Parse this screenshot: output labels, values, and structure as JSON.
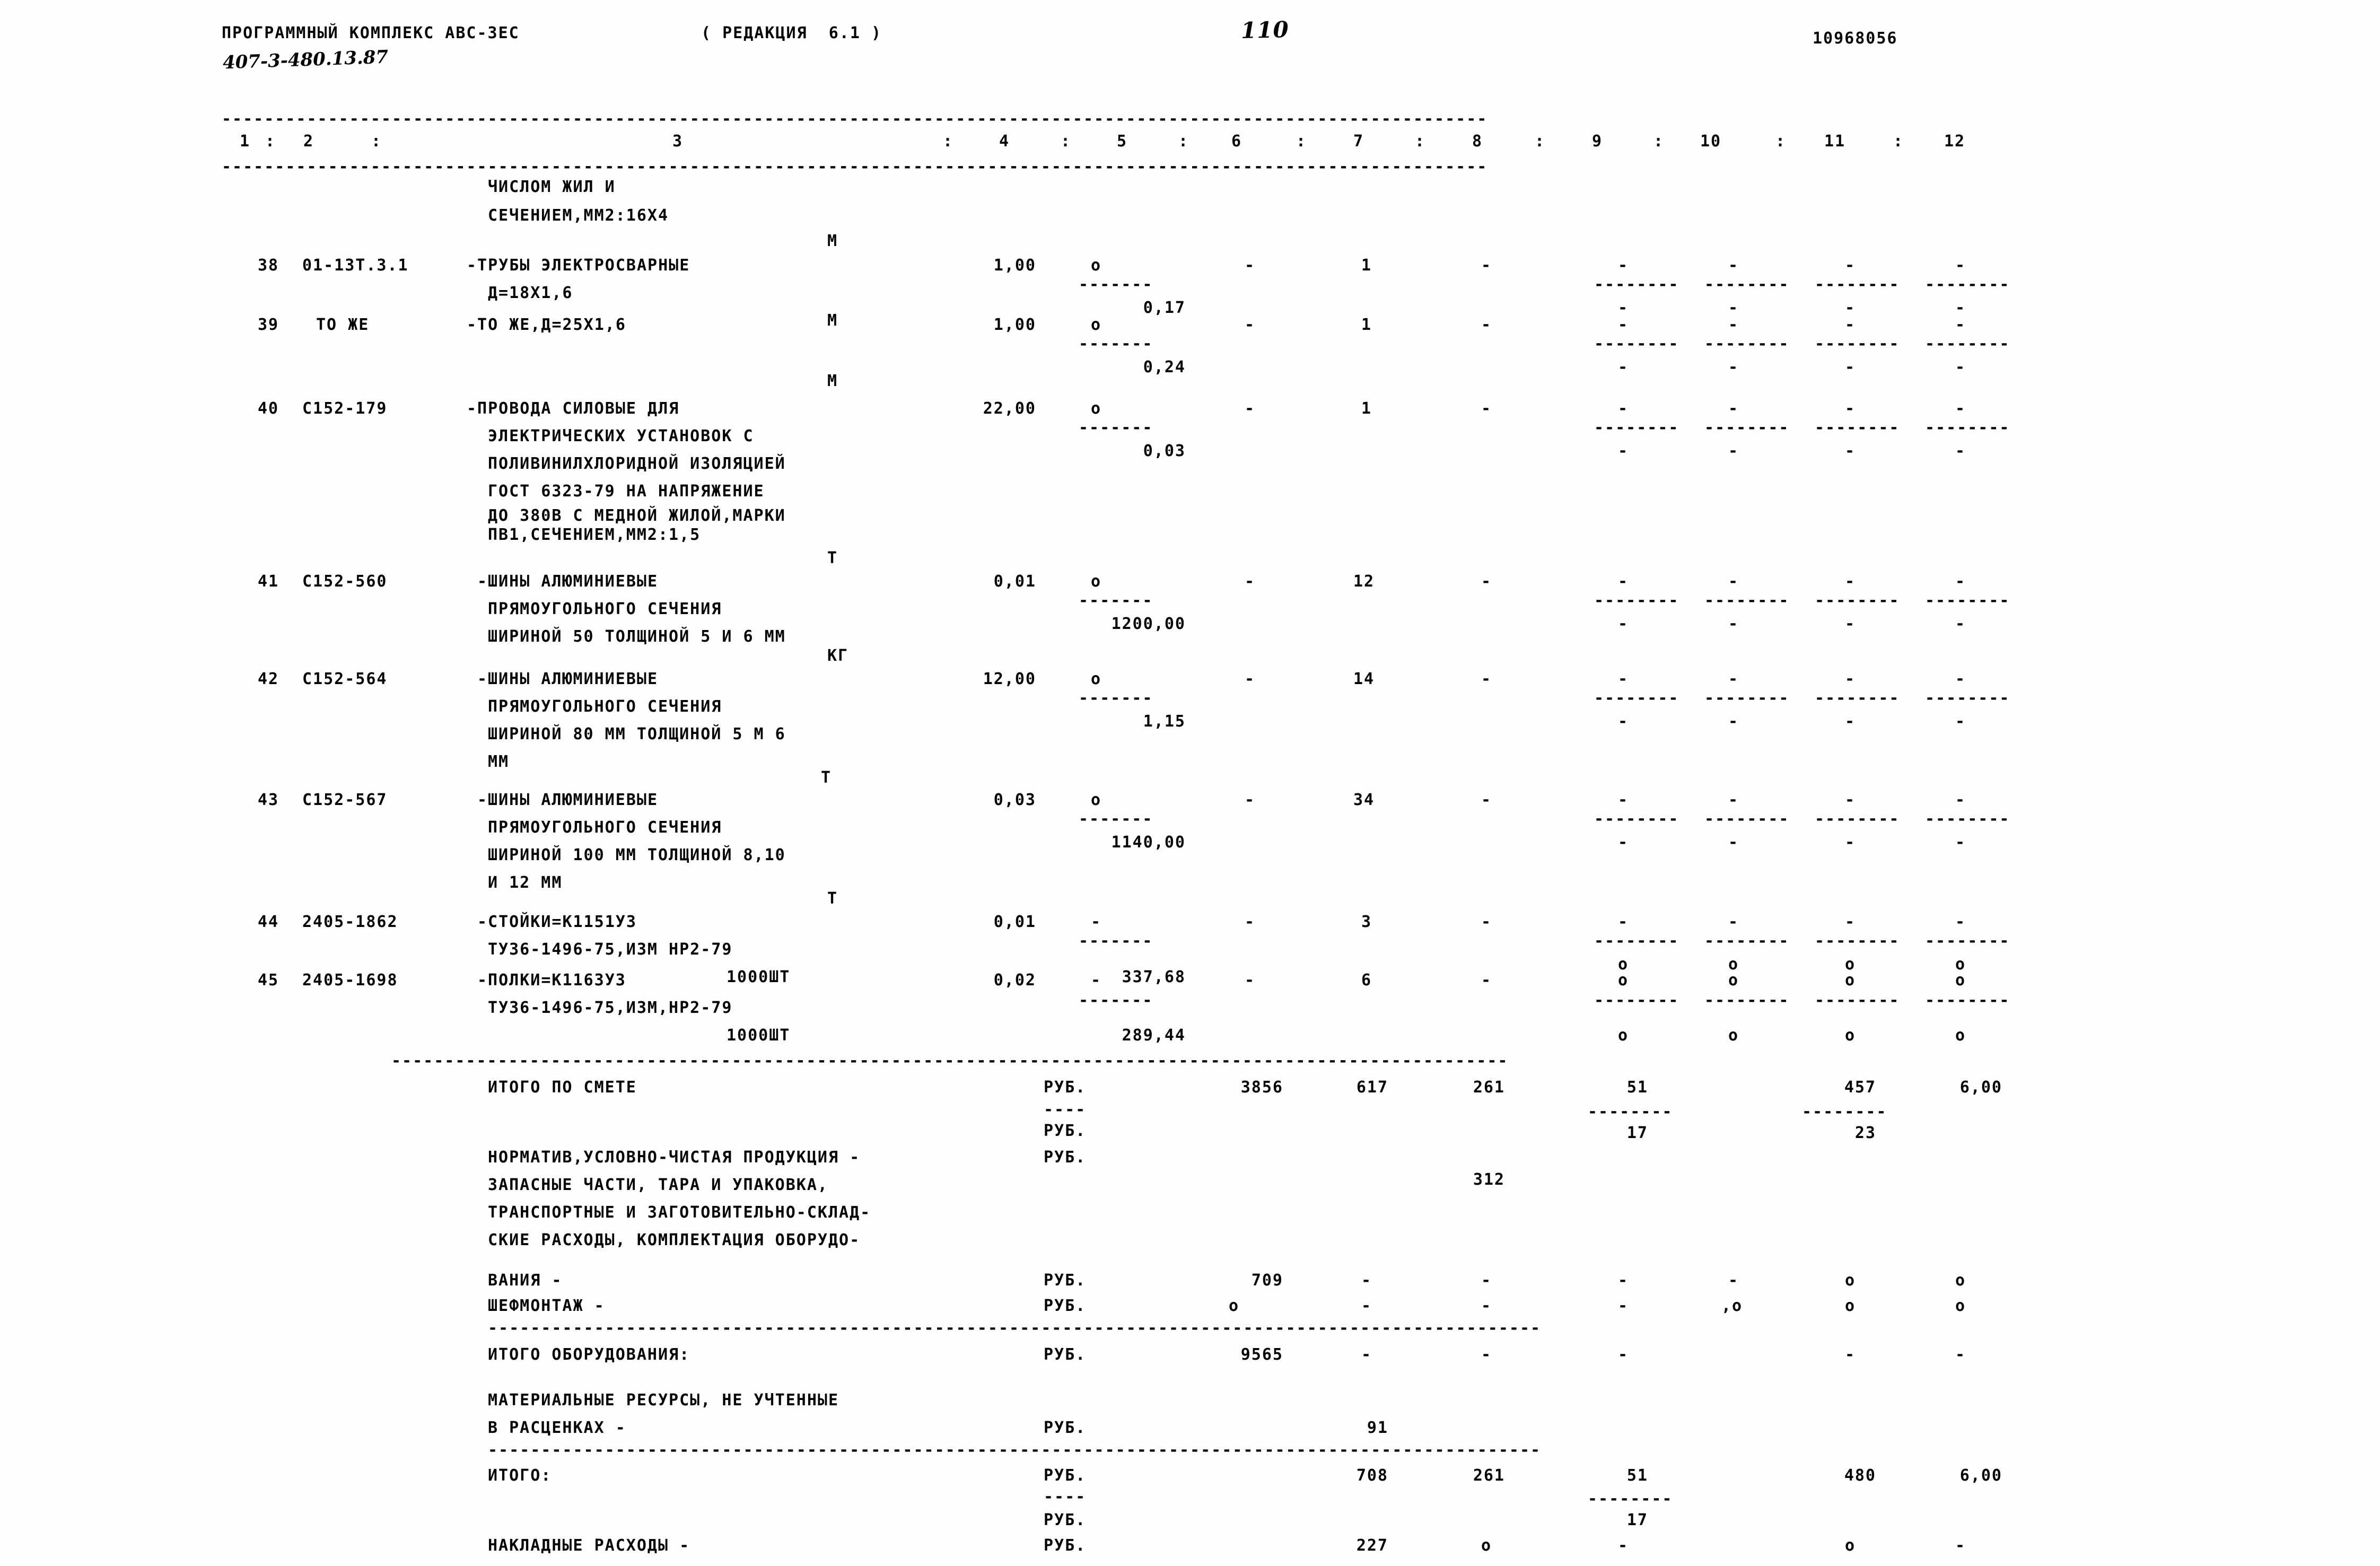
{
  "header": {
    "program_title": "ПРОГРАММНЫЙ КОМПЛЕКС АВС-3ЕС",
    "revision": "( РЕДАКЦИЯ  6.1 )",
    "doc_code": "407-3-480.13.87",
    "page_number": "110",
    "doc_id": "10968056"
  },
  "columns": {
    "separator": ":",
    "labels": [
      "1",
      "2",
      "3",
      "4",
      "5",
      "6",
      "7",
      "8",
      "9",
      "10",
      "11",
      "12"
    ]
  },
  "continued_row": {
    "desc_line1": "ЧИСЛОМ ЖИЛ И",
    "desc_line2": "СЕЧЕНИЕМ,ММ2:16Х4"
  },
  "rows": [
    {
      "num": "38",
      "code": "01-13Т.3.1",
      "desc": [
        "-ТРУБЫ ЭЛЕКТРОСВАРНЫЕ",
        "Д=18Х1,6"
      ],
      "unit": "М",
      "qty": "1,00",
      "price_dot": "o",
      "price": "0,17",
      "c6": "-",
      "c7": "1",
      "c8": "-",
      "c9": "-",
      "c10": "-",
      "c11": "-",
      "c12": "-"
    },
    {
      "num": "39",
      "code": "ТО ЖЕ",
      "desc": [
        "-ТО ЖЕ,Д=25Х1,6"
      ],
      "unit": "М",
      "qty": "1,00",
      "price_dot": "o",
      "price": "0,24",
      "c6": "-",
      "c7": "1",
      "c8": "-",
      "c9": "-",
      "c10": "-",
      "c11": "-",
      "c12": "-"
    },
    {
      "num": "40",
      "code": "С152-179",
      "desc": [
        "-ПРОВОДА СИЛОВЫЕ ДЛЯ",
        "ЭЛЕКТРИЧЕСКИХ УСТАНОВОК С",
        "ПОЛИВИНИЛХЛОРИДНОЙ ИЗОЛЯЦИЕЙ",
        "ГОСТ 6323-79 НА НАПРЯЖЕНИЕ",
        "ДО 380В С МЕДНОЙ ЖИЛОЙ,МАРКИ",
        "ПВ1,СЕЧЕНИЕМ,ММ2:1,5"
      ],
      "unit": "М",
      "qty": "22,00",
      "price_dot": "o",
      "price": "0,03",
      "c6": "-",
      "c7": "1",
      "c8": "-",
      "c9": "-",
      "c10": "-",
      "c11": "-",
      "c12": "-"
    },
    {
      "num": "41",
      "code": "С152-560",
      "desc": [
        "-ШИНЫ АЛЮМИНИЕВЫЕ",
        "ПРЯМОУГОЛЬНОГО СЕЧЕНИЯ",
        "ШИРИНОЙ 50 ТОЛЩИНОЙ 5 И 6 ММ"
      ],
      "unit": "Т",
      "qty": "0,01",
      "price_dot": "o",
      "price": "1200,00",
      "c6": "-",
      "c7": "12",
      "c8": "-",
      "c9": "-",
      "c10": "-",
      "c11": "-",
      "c12": "-"
    },
    {
      "num": "42",
      "code": "С152-564",
      "desc": [
        "-ШИНЫ АЛЮМИНИЕВЫЕ",
        "ПРЯМОУГОЛЬНОГО СЕЧЕНИЯ",
        "ШИРИНОЙ 80 ММ ТОЛЩИНОЙ 5 М 6",
        "ММ"
      ],
      "unit": "КГ",
      "qty": "12,00",
      "price_dot": "o",
      "price": "1,15",
      "c6": "-",
      "c7": "14",
      "c8": "-",
      "c9": "-",
      "c10": "-",
      "c11": "-",
      "c12": "-"
    },
    {
      "num": "43",
      "code": "С152-567",
      "desc": [
        "-ШИНЫ АЛЮМИНИЕВЫЕ",
        "ПРЯМОУГОЛЬНОГО СЕЧЕНИЯ",
        "ШИРИНОЙ 100 ММ ТОЛЩИНОЙ 8,10",
        "И 12 ММ"
      ],
      "unit": "Т",
      "qty": "0,03",
      "price_dot": "o",
      "price": "1140,00",
      "c6": "-",
      "c7": "34",
      "c8": "-",
      "c9": "-",
      "c10": "-",
      "c11": "-",
      "c12": "-"
    },
    {
      "num": "44",
      "code": "2405-1862",
      "desc": [
        "-СТОЙКИ=К1151У3",
        "ТУ36-1496-75,ИЗМ НР2-79"
      ],
      "unit": "1000ШТ",
      "qty": "0,01",
      "price_dot": "-",
      "price": "337,68",
      "c6": "-",
      "c7": "3",
      "c8": "-",
      "c9": "-",
      "c10": "-",
      "c11": "-",
      "c12": "-"
    },
    {
      "num": "45",
      "code": "2405-1698",
      "desc": [
        "-ПОЛКИ=К1163У3",
        "ТУ36-1496-75,ИЗМ,НР2-79"
      ],
      "unit": "1000ШТ",
      "qty": "0,02",
      "price_dot": "-",
      "price": "289,44",
      "c6": "-",
      "c7": "6",
      "c8": "-",
      "c9": "o",
      "c10": "o",
      "c11": "o",
      "c12": "o"
    }
  ],
  "totals": {
    "itogo_po_smete": {
      "label": "ИТОГО ПО СМЕТЕ",
      "unit": "РУБ.",
      "c6": "3856",
      "c7": "617",
      "c8": "261",
      "c9": "51",
      "c11": "457",
      "c12": "6,00",
      "c9_sub": "17",
      "c11_sub": "23"
    },
    "normativ": {
      "unit1": "РУБ.",
      "unit2": "РУБ.",
      "lines": [
        "НОРМАТИВ,УСЛОВНО-ЧИСТАЯ ПРОДУКЦИЯ -",
        "ЗАПАСНЫЕ ЧАСТИ, ТАРА И УПАКОВКА,",
        "ТРАНСПОРТНЫЕ И ЗАГОТОВИТЕЛЬНО-СКЛАД-",
        "СКИЕ РАСХОДЫ, КОМПЛЕКТАЦИЯ ОБОРУДО-"
      ],
      "c8": "312"
    },
    "vaniya": {
      "label": "ВАНИЯ -",
      "unit": "РУБ.",
      "c6": "709",
      "c7": "-",
      "c8": "-",
      "c9": "-",
      "c10": "-",
      "c11": "o",
      "c12": "o"
    },
    "shefmontazh": {
      "label": "ШЕФМОНТАЖ -",
      "unit": "РУБ.",
      "c6": "o",
      "c7": "-",
      "c8": "-",
      "c9": "-",
      "c10": ",o",
      "c11": "o",
      "c12": "o"
    },
    "itogo_oborudovaniya": {
      "label": "ИТОГО ОБОРУДОВАНИЯ:",
      "unit": "РУБ.",
      "c6": "9565",
      "c7": "-",
      "c8": "-",
      "c9": "-",
      "c11": "-",
      "c12": "-"
    },
    "mat_resursy": {
      "line1": "МАТЕРИАЛЬНЫЕ РЕСУРСЫ, НЕ УЧТЕННЫЕ",
      "line2": "В РАСЦЕНКАХ -",
      "unit": "РУБ.",
      "c7": "91"
    },
    "itogo": {
      "label": "ИТОГО:",
      "unit": "РУБ.",
      "unit2": "РУБ.",
      "c7": "708",
      "c8": "261",
      "c9": "51",
      "c9_sub": "17",
      "c11": "480",
      "c12": "6,00"
    },
    "nakladnye": {
      "label": "НАКЛАДНЫЕ РАСХОДЫ -",
      "unit": "РУБ.",
      "c7": "227",
      "c8": "o",
      "c9": "-",
      "c11": "o",
      "c12": "-"
    }
  },
  "glyphs": {
    "dash_dot": "-",
    "small_o": "o"
  }
}
